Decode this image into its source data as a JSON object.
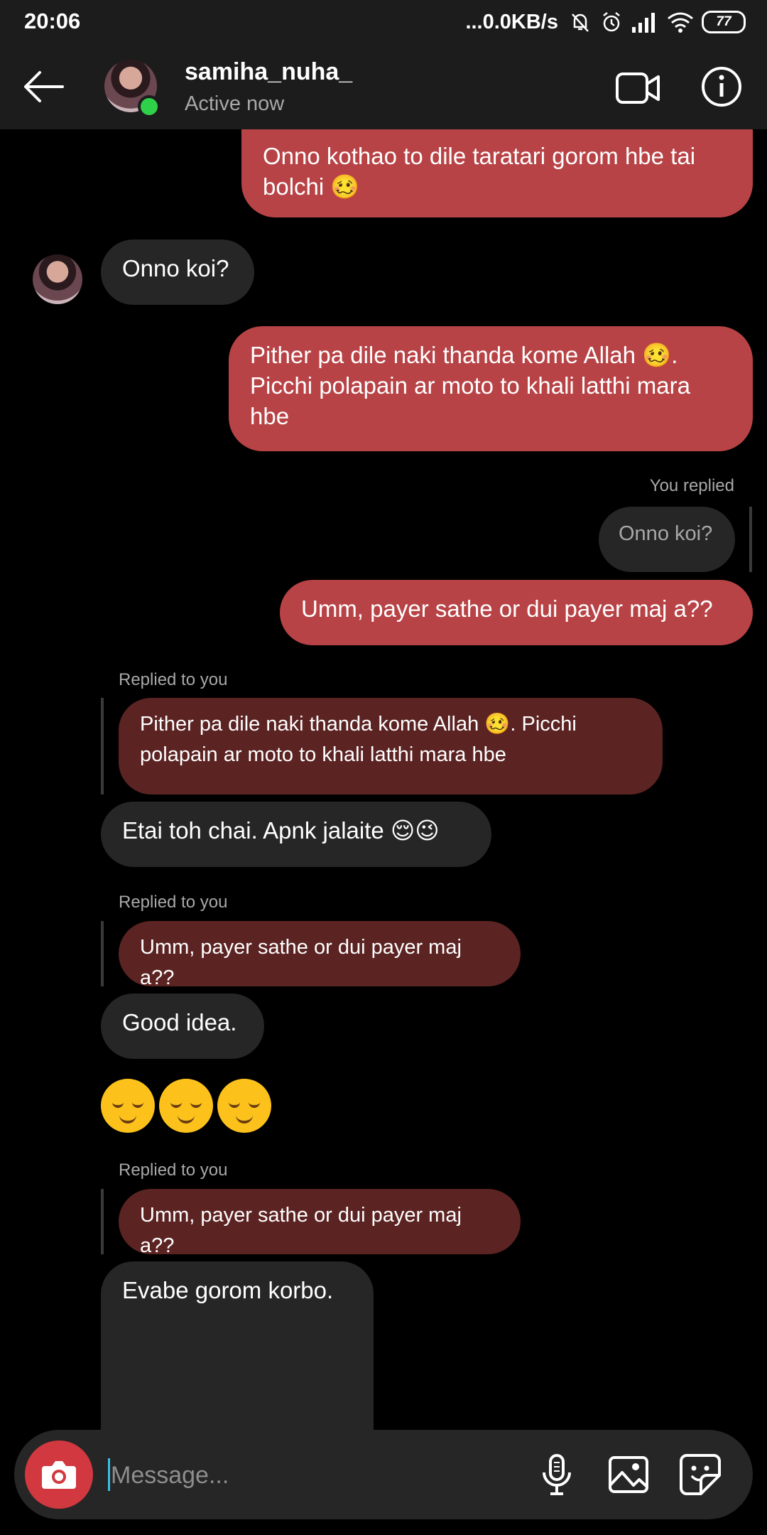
{
  "status_bar": {
    "time": "20:06",
    "network_speed": "...0.0KB/s",
    "battery": "77"
  },
  "header": {
    "username": "samiha_nuha_",
    "status": "Active now"
  },
  "messages": {
    "m1": "Onno kothao to dile taratari gorom hbe tai bolchi 🥴",
    "m2": "Onno koi?",
    "m3": "Pither pa dile naki thanda kome Allah 🥴. Picchi polapain ar moto to khali latthi mara hbe",
    "reply_label_you": "You replied",
    "reply_quote_you": "Onno koi?",
    "m4": "Umm, payer sathe or dui payer maj a??",
    "replied_label_1": "Replied to you",
    "quote_1": "Pither pa dile naki thanda kome Allah 🥴. Picchi polapain ar moto to khali latthi mara hbe",
    "m5": "Etai toh chai. Apnk jalaite 😌😉",
    "replied_label_2": "Replied to you",
    "quote_2": "Umm, payer sathe or dui payer maj a??",
    "m6": "Good idea.",
    "replied_label_3": "Replied to you",
    "quote_3": "Umm, payer sathe or dui payer maj a??",
    "m7": "Evabe gorom korbo."
  },
  "composer": {
    "placeholder": "Message..."
  },
  "colors": {
    "sent_bubble": "#b84346",
    "received_bubble": "#262626",
    "quote_bubble": "#5c2323",
    "online_dot": "#2fd14a"
  },
  "icons": [
    "back-arrow-icon",
    "video-call-icon",
    "info-icon",
    "camera-icon",
    "microphone-icon",
    "gallery-icon",
    "sticker-icon",
    "relieved-face-emoji"
  ]
}
